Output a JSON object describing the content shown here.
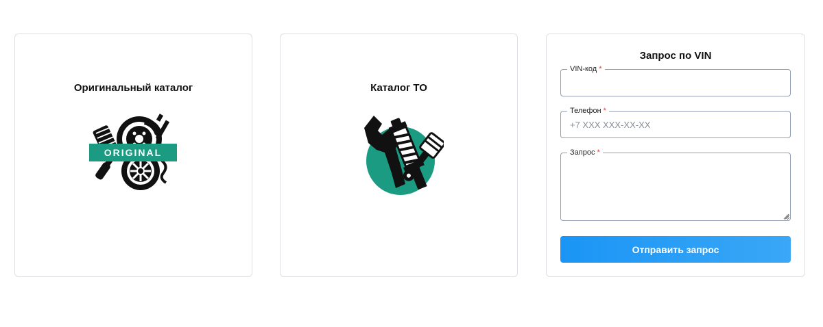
{
  "catalogs": [
    {
      "title": "Оригинальный каталог",
      "badge_text": "ORIGINAL",
      "icon": "original-parts-icon"
    },
    {
      "title": "Каталог ТО",
      "icon": "maintenance-tools-icon"
    }
  ],
  "vin_form": {
    "title": "Запрос по VIN",
    "required_mark": "*",
    "fields": {
      "vin": {
        "label": "VIN-код",
        "value": "",
        "placeholder": ""
      },
      "phone": {
        "label": "Телефон",
        "value": "",
        "placeholder": "+7 XXX XXX-XX-XX"
      },
      "request": {
        "label": "Запрос",
        "value": "",
        "placeholder": ""
      }
    },
    "submit_label": "Отправить запрос"
  },
  "colors": {
    "accent_green": "#1a9b82",
    "button_blue": "#1a95f5",
    "required_red": "#e53935",
    "border": "#dcdfe3"
  }
}
